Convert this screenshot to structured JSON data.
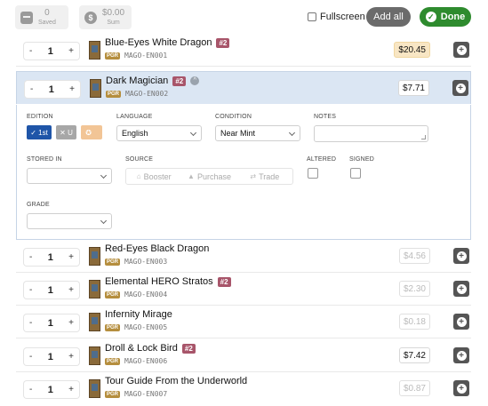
{
  "topbar": {
    "saved": {
      "value": "0",
      "label": "Saved",
      "icon": "archive-icon"
    },
    "sum": {
      "value": "$0.00",
      "label": "Sum",
      "icon": "dollar-coin-icon"
    },
    "foil_label": "Fullscreen",
    "add_all_label": "Add all",
    "done_label": "Done"
  },
  "cards": [
    {
      "qty": "1",
      "name": "Blue-Eyes White Dragon",
      "tag": "#2",
      "rarity": "PGR",
      "code": "MAGO-EN001",
      "price": "$20.45",
      "price_style": "gold"
    },
    {
      "qty": "1",
      "name": "Dark Magician",
      "tag": "#2",
      "rarity": "PGR",
      "code": "MAGO-EN002",
      "price": "$7.71",
      "price_style": "dark"
    },
    {
      "qty": "1",
      "name": "Red-Eyes Black Dragon",
      "tag": "",
      "rarity": "PGR",
      "code": "MAGO-EN003",
      "price": "$4.56",
      "price_style": "muted"
    },
    {
      "qty": "1",
      "name": "Elemental HERO Stratos",
      "tag": "#2",
      "rarity": "PGR",
      "code": "MAGO-EN004",
      "price": "$2.30",
      "price_style": "muted"
    },
    {
      "qty": "1",
      "name": "Infernity Mirage",
      "tag": "",
      "rarity": "PGR",
      "code": "MAGO-EN005",
      "price": "$0.18",
      "price_style": "muted"
    },
    {
      "qty": "1",
      "name": "Droll & Lock Bird",
      "tag": "#2",
      "rarity": "PGR",
      "code": "MAGO-EN006",
      "price": "$7.42",
      "price_style": "dark"
    },
    {
      "qty": "1",
      "name": "Tour Guide From the Underworld",
      "tag": "",
      "rarity": "PGR",
      "code": "MAGO-EN007",
      "price": "$0.87",
      "price_style": "muted"
    }
  ],
  "detail": {
    "edition_label": "EDITION",
    "edition_options": [
      "1st",
      "U",
      "L"
    ],
    "language_label": "LANGUAGE",
    "language_value": "English",
    "condition_label": "CONDITION",
    "condition_value": "Near Mint",
    "notes_label": "NOTES",
    "stored_in_label": "STORED IN",
    "stored_in_value": "",
    "source_label": "SOURCE",
    "source_options": [
      "Booster",
      "Purchase",
      "Trade"
    ],
    "altered_label": "ALTERED",
    "signed_label": "SIGNED",
    "grade_label": "GRADE",
    "grade_value": ""
  },
  "symbols": {
    "minus": "-",
    "plus": "+",
    "plus_circle": "+",
    "check": "✓",
    "chevron_up": "^"
  }
}
